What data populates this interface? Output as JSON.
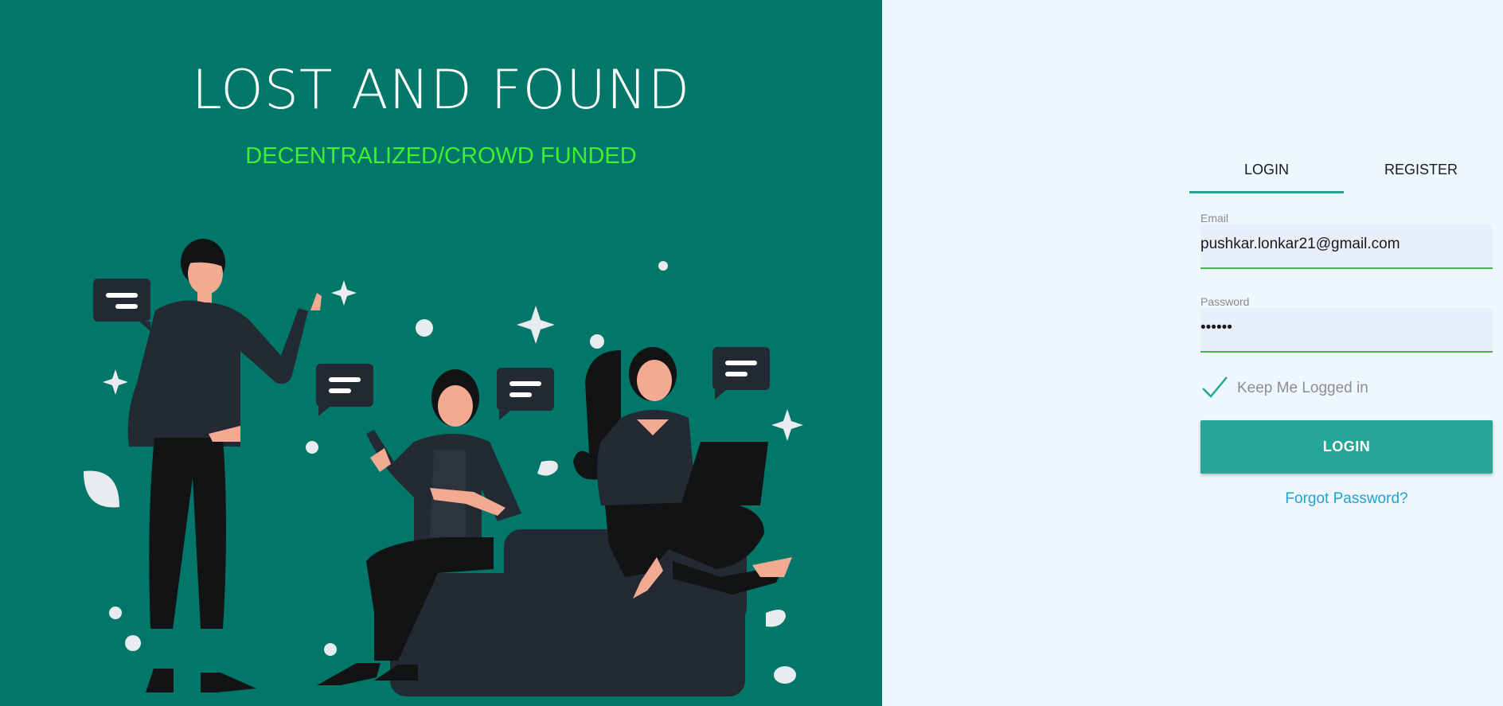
{
  "hero": {
    "title": "LOST AND FOUND",
    "tagline": "DECENTRALIZED/CROWD FUNDED",
    "illustration": "people-chatting-illustration"
  },
  "auth": {
    "tabs": [
      {
        "label": "LOGIN",
        "active": true
      },
      {
        "label": "REGISTER",
        "active": false
      }
    ],
    "email": {
      "label": "Email",
      "value": "pushkar.lonkar21@gmail.com"
    },
    "password": {
      "label": "Password",
      "value": "••••••"
    },
    "remember": {
      "label": "Keep Me Logged in",
      "checked": true,
      "icon": "check-icon"
    },
    "login_button": "LOGIN",
    "forgot_link": "Forgot Password?"
  },
  "colors": {
    "left_bg": "#01776a",
    "right_bg": "#eff7fe",
    "accent": "#26a696",
    "tagline": "#3ef030",
    "link": "#1ea2d6",
    "input_underline": "#4caf50"
  }
}
